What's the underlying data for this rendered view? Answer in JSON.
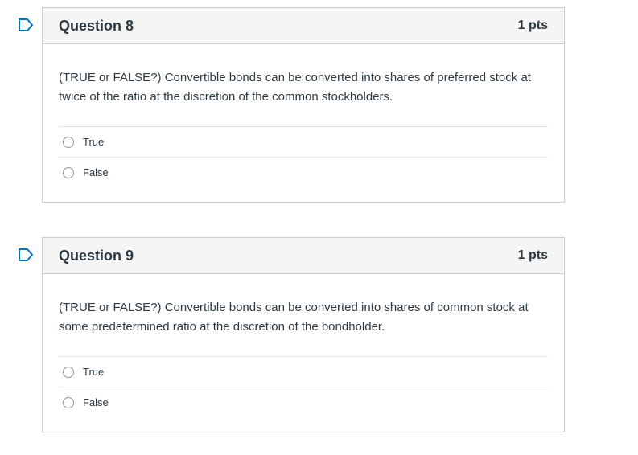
{
  "accent_color": "#0374b5",
  "questions": [
    {
      "title": "Question 8",
      "points": "1 pts",
      "text": "(TRUE or FALSE?) Convertible bonds can be converted into shares of preferred stock at twice of the ratio at the discretion of the common stockholders.",
      "answers": [
        "True",
        "False"
      ]
    },
    {
      "title": "Question 9",
      "points": "1 pts",
      "text": "(TRUE or FALSE?) Convertible bonds can be converted into shares of common stock at some predetermined ratio at the discretion of the bondholder.",
      "answers": [
        "True",
        "False"
      ]
    }
  ]
}
